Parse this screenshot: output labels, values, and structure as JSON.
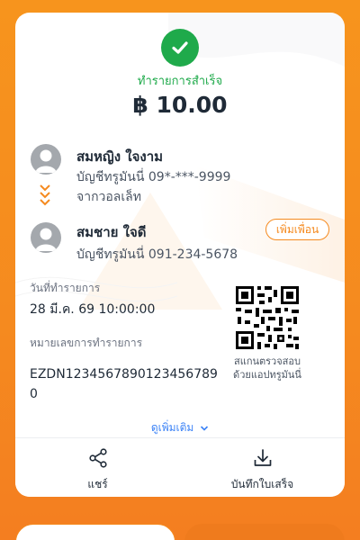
{
  "status": {
    "text": "ทำรายการสำเร็จ"
  },
  "amount": "฿ 10.00",
  "sender": {
    "name": "สมหญิง ใจงาม",
    "account": "บัญชีทรูมันนี่ 09*-***-9999",
    "source": "จากวอลเล็ท"
  },
  "receiver": {
    "name": "สมชาย ใจดี",
    "account": "บัญชีทรูมันนี่ 091-234-5678",
    "add_friend_label": "เพิ่มเพื่อน"
  },
  "transaction": {
    "date_label": "วันที่ทำรายการ",
    "date_value": "28 มี.ค. 69 10:00:00",
    "id_label": "หมายเลขการทำรายการ",
    "id_value": "EZDN12345678901234567890"
  },
  "qr": {
    "caption_line1": "สแกนตรวจสอบ",
    "caption_line2": "ด้วยแอปทรูมันนี่"
  },
  "more_label": "ดูเพิ่มเติม",
  "actions": {
    "share_label": "แชร์",
    "save_label": "บันทึกใบเสร็จ"
  },
  "colors": {
    "success": "#1faa4b",
    "brand": "#f58a1f",
    "link": "#3b82f6"
  }
}
